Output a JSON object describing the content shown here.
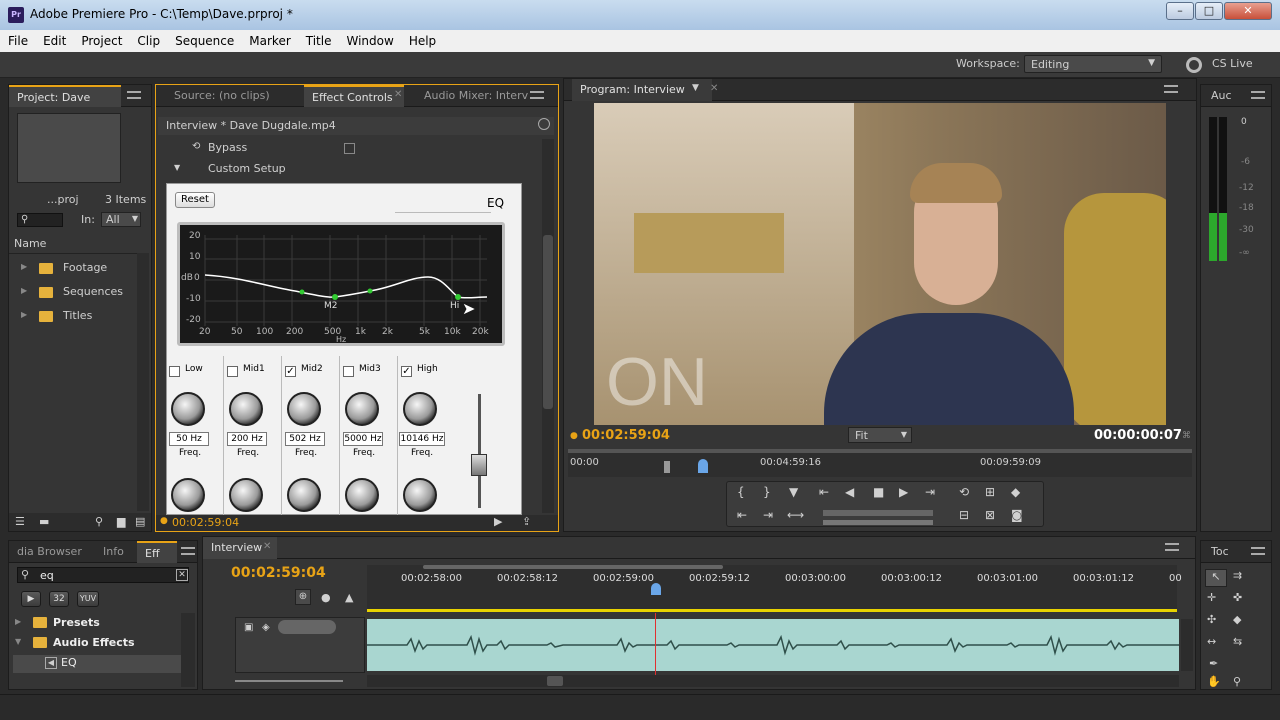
{
  "window": {
    "title": "Adobe Premiere Pro - C:\\Temp\\Dave.prproj *",
    "app_icon": "Pr"
  },
  "menu": [
    "File",
    "Edit",
    "Project",
    "Clip",
    "Sequence",
    "Marker",
    "Title",
    "Window",
    "Help"
  ],
  "workspace": {
    "label": "Workspace:",
    "value": "Editing",
    "cslive": "CS Live"
  },
  "project_panel": {
    "tab": "Project: Dave",
    "filename": "...proj",
    "items": "3 Items",
    "in_label": "In:",
    "in_value": "All",
    "name_header": "Name",
    "folders": [
      "Footage",
      "Sequences",
      "Titles"
    ]
  },
  "source_tabs": {
    "source": "Source: (no clips)",
    "effect_controls": "Effect Controls",
    "audio_mixer": "Audio Mixer: Interv"
  },
  "effect_controls": {
    "clip": "Interview * Dave Dugdale.mp4",
    "bypass": "Bypass",
    "custom_setup": "Custom Setup",
    "reset": "Reset",
    "eq_label": "EQ",
    "db_ticks": [
      "20",
      "10",
      "0",
      "-10",
      "-20"
    ],
    "db_label": "dB",
    "hz_ticks": [
      "20",
      "50",
      "100",
      "200",
      "500",
      "1k",
      "2k",
      "5k",
      "10k",
      "20k"
    ],
    "hz_label": "Hz",
    "markers": [
      "M2",
      "Hi"
    ],
    "bands": [
      {
        "name": "Low",
        "checked": false,
        "freq": "50 Hz"
      },
      {
        "name": "Mid1",
        "checked": false,
        "freq": "200 Hz"
      },
      {
        "name": "Mid2",
        "checked": true,
        "freq": "502 Hz"
      },
      {
        "name": "Mid3",
        "checked": false,
        "freq": "5000 Hz"
      },
      {
        "name": "High",
        "checked": true,
        "freq": "10146 Hz"
      }
    ],
    "freq_label": "Freq.",
    "check_mark": "✓",
    "timecode": "00:02:59:04"
  },
  "program": {
    "tab": "Program: Interview",
    "overlay_text": "ON",
    "timecode_left": "00:02:59:04",
    "fit": "Fit",
    "timecode_right": "00:00:00:07",
    "ruler": [
      "00:00",
      "00:04:59:16",
      "00:09:59:09"
    ],
    "audio_tab": "Auc",
    "meter_ticks": [
      "0",
      "-6",
      "-12",
      "-18",
      "-30",
      "-∞"
    ]
  },
  "effects_panel": {
    "tabs": [
      "dia Browser",
      "Info",
      "Eff"
    ],
    "search": "eq",
    "items": [
      {
        "name": "Presets",
        "level": 0
      },
      {
        "name": "Audio Effects",
        "level": 0
      },
      {
        "name": "EQ",
        "level": 1
      }
    ],
    "btn_labels": [
      "32",
      "YUV"
    ]
  },
  "timeline": {
    "tab": "Interview",
    "timecode": "00:02:59:04",
    "ruler": [
      "00:02:58:00",
      "00:02:58:12",
      "00:02:59:00",
      "00:02:59:12",
      "00:03:00:00",
      "00:03:00:12",
      "00:03:01:00",
      "00:03:01:12",
      "00"
    ]
  },
  "tools": {
    "tab": "Toc"
  }
}
